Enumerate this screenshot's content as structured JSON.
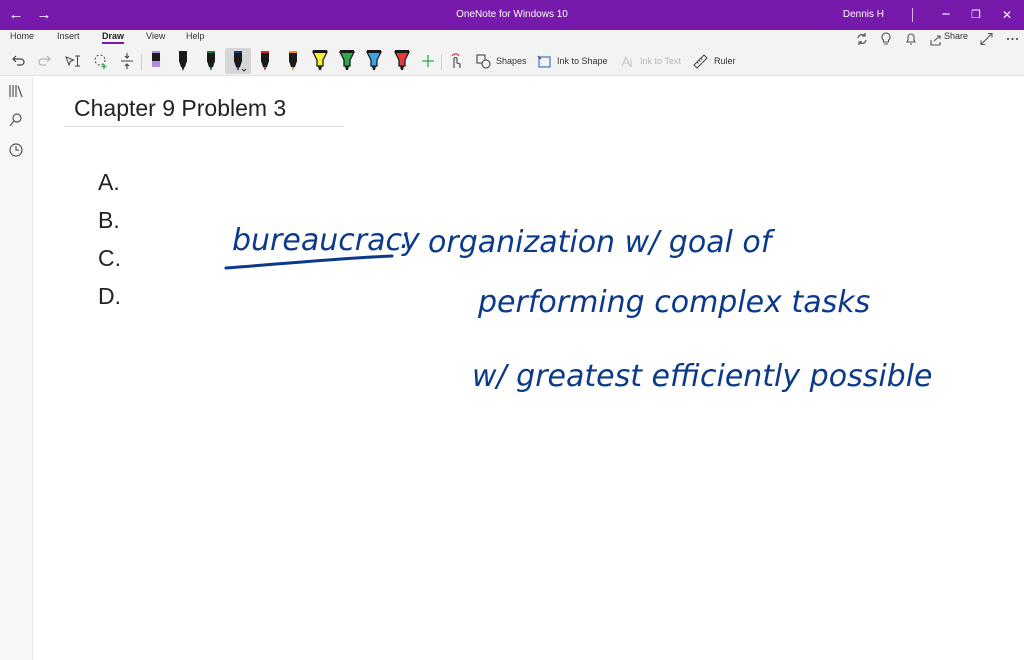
{
  "window": {
    "title": "OneNote for Windows 10",
    "user": "Dennis H",
    "back_glyph": "←",
    "forward_glyph": "→",
    "minimize_glyph": "−",
    "restore_glyph": "❐",
    "close_glyph": "✕",
    "accent": "#7719aa"
  },
  "ribbon": {
    "tabs": [
      {
        "label": "Home"
      },
      {
        "label": "Insert"
      },
      {
        "label": "Draw",
        "active": true
      },
      {
        "label": "View"
      },
      {
        "label": "Help"
      }
    ],
    "share_label": "Share"
  },
  "toolbar": {
    "shapes_label": "Shapes",
    "ink_to_shape_label": "Ink to Shape",
    "ink_to_text_label": "Ink to Text",
    "ruler_label": "Ruler",
    "pens": [
      {
        "type": "pen",
        "color": "#1a1a1a",
        "tip": "#b48ae0"
      },
      {
        "type": "pen",
        "color": "#1a1a1a",
        "tip": "#1a1a1a"
      },
      {
        "type": "pen",
        "color": "#1a1a1a",
        "tip": "#1e7a3c"
      },
      {
        "type": "pen",
        "color": "#1a1a1a",
        "tip": "#0b3a8a",
        "selected": true
      },
      {
        "type": "pen",
        "color": "#1a1a1a",
        "tip": "#d42a2a"
      },
      {
        "type": "pen",
        "color": "#1a1a1a",
        "tip": "#f08c1e"
      },
      {
        "type": "highlighter",
        "color": "#1a1a1a",
        "tip": "#f7f035"
      },
      {
        "type": "highlighter",
        "color": "#1a1a1a",
        "tip": "#2ea84a"
      },
      {
        "type": "highlighter",
        "color": "#1a1a1a",
        "tip": "#38a8e8"
      },
      {
        "type": "highlighter",
        "color": "#1a1a1a",
        "tip": "#e23a3a"
      }
    ]
  },
  "page": {
    "title": "Chapter 9 Problem 3",
    "outline": [
      "A.",
      "B.",
      "C.",
      "D."
    ],
    "ink": {
      "term": "bureaucracy",
      "colon": ":",
      "line1": "organization  w/  goal  of",
      "line2": "performing  complex  tasks",
      "line3": "w/  greatest  efficiently  possible",
      "color": "#0b3a8a"
    }
  }
}
